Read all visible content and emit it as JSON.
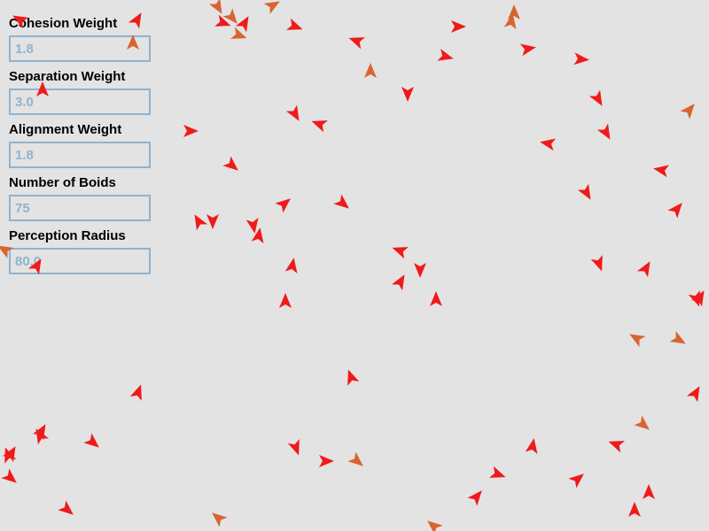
{
  "controls": {
    "cohesion": {
      "label": "Cohesion Weight",
      "value": "1.8"
    },
    "separation": {
      "label": "Separation Weight",
      "value": "3.0"
    },
    "alignment": {
      "label": "Alignment Weight",
      "value": "1.8"
    },
    "num_boids": {
      "label": "Number of Boids",
      "value": "75"
    },
    "perception": {
      "label": "Perception Radius",
      "value": "80.0"
    }
  },
  "colors": {
    "background": "#e3e3e3",
    "boid_primary": "#f01a1a",
    "boid_secondary": "#d9642e",
    "input_text": "#8fb3cf",
    "input_border": "#8fb3cf"
  }
}
